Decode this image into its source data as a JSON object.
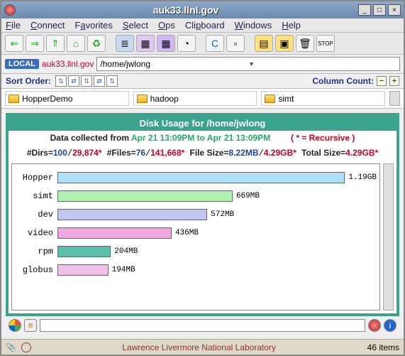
{
  "title": "auk33.llnl.gov",
  "menu": [
    "File",
    "Connect",
    "Favorites",
    "Select",
    "Ops",
    "Clipboard",
    "Windows",
    "Help"
  ],
  "pathbar": {
    "badge": "LOCAL",
    "host": "auk33.llnl.gov",
    "path": "/home/jwlong"
  },
  "sortline": {
    "sort": "Sort Order:",
    "colcount": "Column Count:"
  },
  "folders": [
    "HopperDemo",
    "hadoop",
    "simt"
  ],
  "panel": {
    "title": "Disk Usage for /home/jwlong",
    "collected_prefix": "Data collected from ",
    "collected_range": "Apr 21 13:09PM to Apr 21 13:09PM",
    "recursive": "( * = Recursive )",
    "stats": {
      "dirs_lbl": "#Dirs=",
      "dirs_a": "100",
      "dirs_b": "29,874*",
      "files_lbl": "#Files=",
      "files_a": "76",
      "files_b": "141,668*",
      "fsize_lbl": "File Size=",
      "fsize_a": "8.22MB",
      "fsize_b": "4.29GB*",
      "tsize_lbl": "Total Size=",
      "tsize_b": "4.29GB*"
    }
  },
  "chart_data": {
    "type": "bar",
    "title": "Disk Usage for /home/jwlong",
    "xlabel": "",
    "ylabel": "",
    "max_mb": 1219,
    "series": [
      {
        "name": "Hopper",
        "mb": 1219,
        "label": "1.19GB",
        "color": "#b0e0f8"
      },
      {
        "name": "simt",
        "mb": 669,
        "label": "669MB",
        "color": "#b0f0b0"
      },
      {
        "name": "dev",
        "mb": 572,
        "label": "572MB",
        "color": "#c0c8f0"
      },
      {
        "name": "video",
        "mb": 436,
        "label": "436MB",
        "color": "#f0a8e0"
      },
      {
        "name": "rpm",
        "mb": 204,
        "label": "204MB",
        "color": "#5ac0a8"
      },
      {
        "name": "globus",
        "mb": 194,
        "label": "194MB",
        "color": "#f0c0e8"
      }
    ]
  },
  "status": {
    "lab": "Lawrence Livermore National Laboratory",
    "items": "46 items"
  }
}
